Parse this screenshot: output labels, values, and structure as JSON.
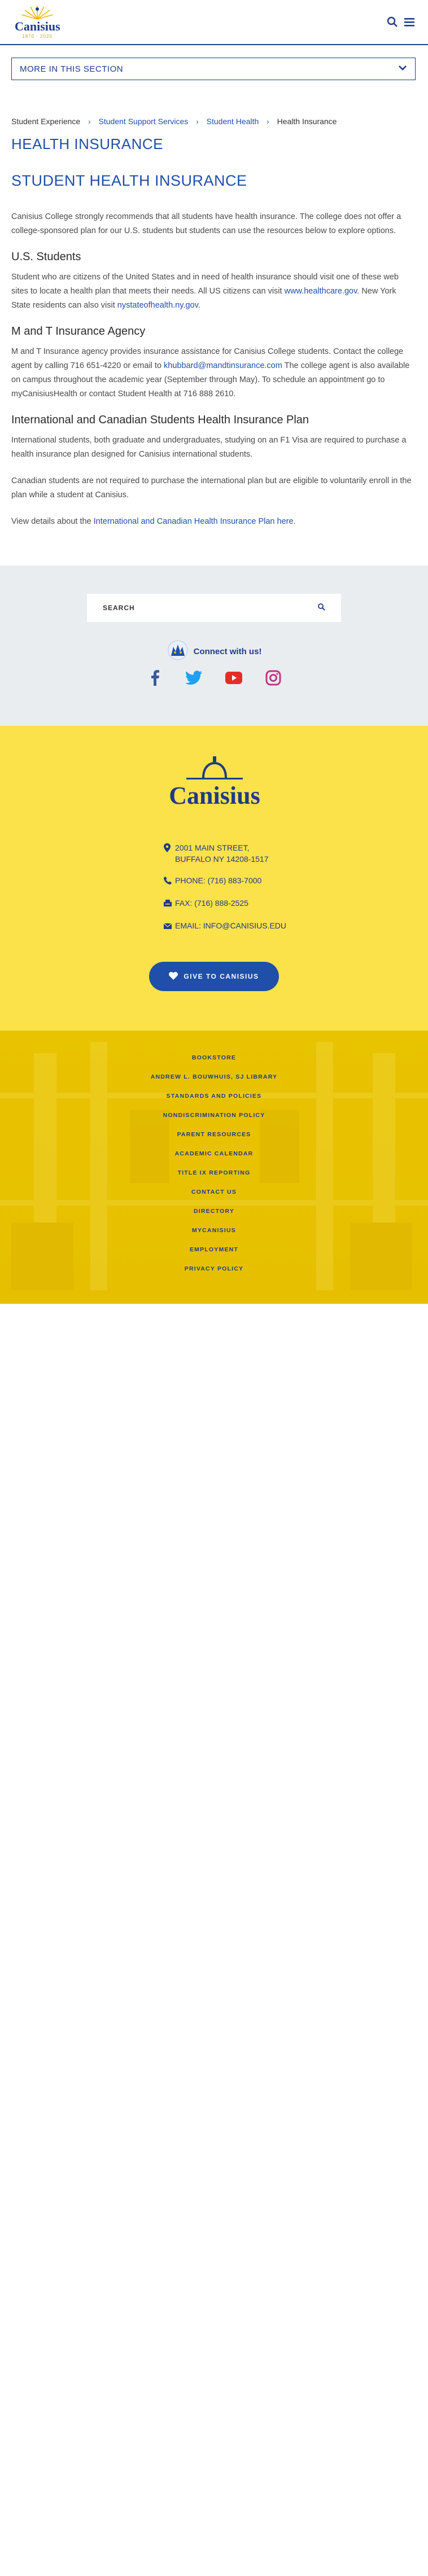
{
  "header": {
    "logo_text": "Canisius",
    "logo_years": "1870 · 2020",
    "search_icon": "search-icon",
    "menu_icon": "hamburger-menu-icon"
  },
  "section_nav": {
    "label": "MORE IN THIS SECTION",
    "icon": "chevron-down-icon"
  },
  "breadcrumb": [
    {
      "label": "Student Experience",
      "link": false
    },
    {
      "label": "Student Support Services",
      "link": true
    },
    {
      "label": "Student Health",
      "link": true
    },
    {
      "label": "Health Insurance",
      "link": false
    }
  ],
  "section_title": "HEALTH INSURANCE",
  "page_title": "STUDENT HEALTH INSURANCE",
  "content": {
    "intro": "Canisius College strongly recommends that all students have health insurance. The college does not offer a college-sponsored plan for our U.S. students but students can use the resources below to explore options.",
    "us_heading": "U.S. Students",
    "us_text_1": "Student who are citizens of the United States and in need of health insurance should visit one of these web sites to locate a health plan that meets their needs. All US citizens can visit ",
    "us_link_1": "www.healthcare.gov",
    "us_text_2": ". New York State residents can also visit ",
    "us_link_2": "nystateofhealth.ny.gov",
    "us_text_3": ".",
    "mt_heading": "M and T Insurance Agency",
    "mt_text_1": "M and T Insurance agency provides insurance assistance for Canisius College students. Contact the college agent by calling 716 651-4220 or email to ",
    "mt_link": "khubbard@mandtinsurance.com",
    "mt_text_2": " The college agent is also available on campus throughout the academic year (September through May). To schedule an appointment go to myCanisiusHealth or contact Student Health at 716 888 2610.",
    "intl_heading": "International and Canadian Students Health Insurance Plan",
    "intl_text": "International students, both graduate and undergraduates, studying on an F1 Visa are required to purchase a health insurance plan designed for Canisius international students.",
    "canada_text": "Canadian students are not required to purchase the international plan but are eligible to voluntarily enroll in the plan while a student at Canisius.",
    "view_text": "View details about the ",
    "view_link": "International and Canadian Health Insurance Plan here",
    "view_end": "."
  },
  "search": {
    "placeholder": "SEARCH",
    "icon": "search-icon"
  },
  "connect": {
    "label": "Connect with us!"
  },
  "socials": [
    {
      "name": "facebook-icon",
      "color": "#3b5998"
    },
    {
      "name": "twitter-icon",
      "color": "#1da1f2"
    },
    {
      "name": "youtube-icon",
      "color": "#e52d27"
    },
    {
      "name": "instagram-icon",
      "color": "#c13584"
    }
  ],
  "footer": {
    "logo_text": "Canisius",
    "address_line1": "2001 MAIN STREET,",
    "address_line2": "BUFFALO NY 14208-1517",
    "phone": "PHONE: (716) 883-7000",
    "fax": "FAX: (716) 888-2525",
    "email": "EMAIL: INFO@CANISIUS.EDU",
    "give_label": "GIVE TO CANISIUS"
  },
  "footer_links": [
    "BOOKSTORE",
    "ANDREW L. BOUWHUIS, SJ LIBRARY",
    "STANDARDS AND POLICIES",
    "NONDISCRIMINATION POLICY",
    "PARENT RESOURCES",
    "ACADEMIC CALENDAR",
    "TITLE IX REPORTING",
    "CONTACT US",
    "DIRECTORY",
    "MYCANISIUS",
    "EMPLOYMENT",
    "PRIVACY POLICY"
  ],
  "colors": {
    "brand_blue": "#1e3a8a",
    "link_blue": "#1f4fa8",
    "brand_yellow": "#fbe14a",
    "search_band": "#eaedf0"
  }
}
